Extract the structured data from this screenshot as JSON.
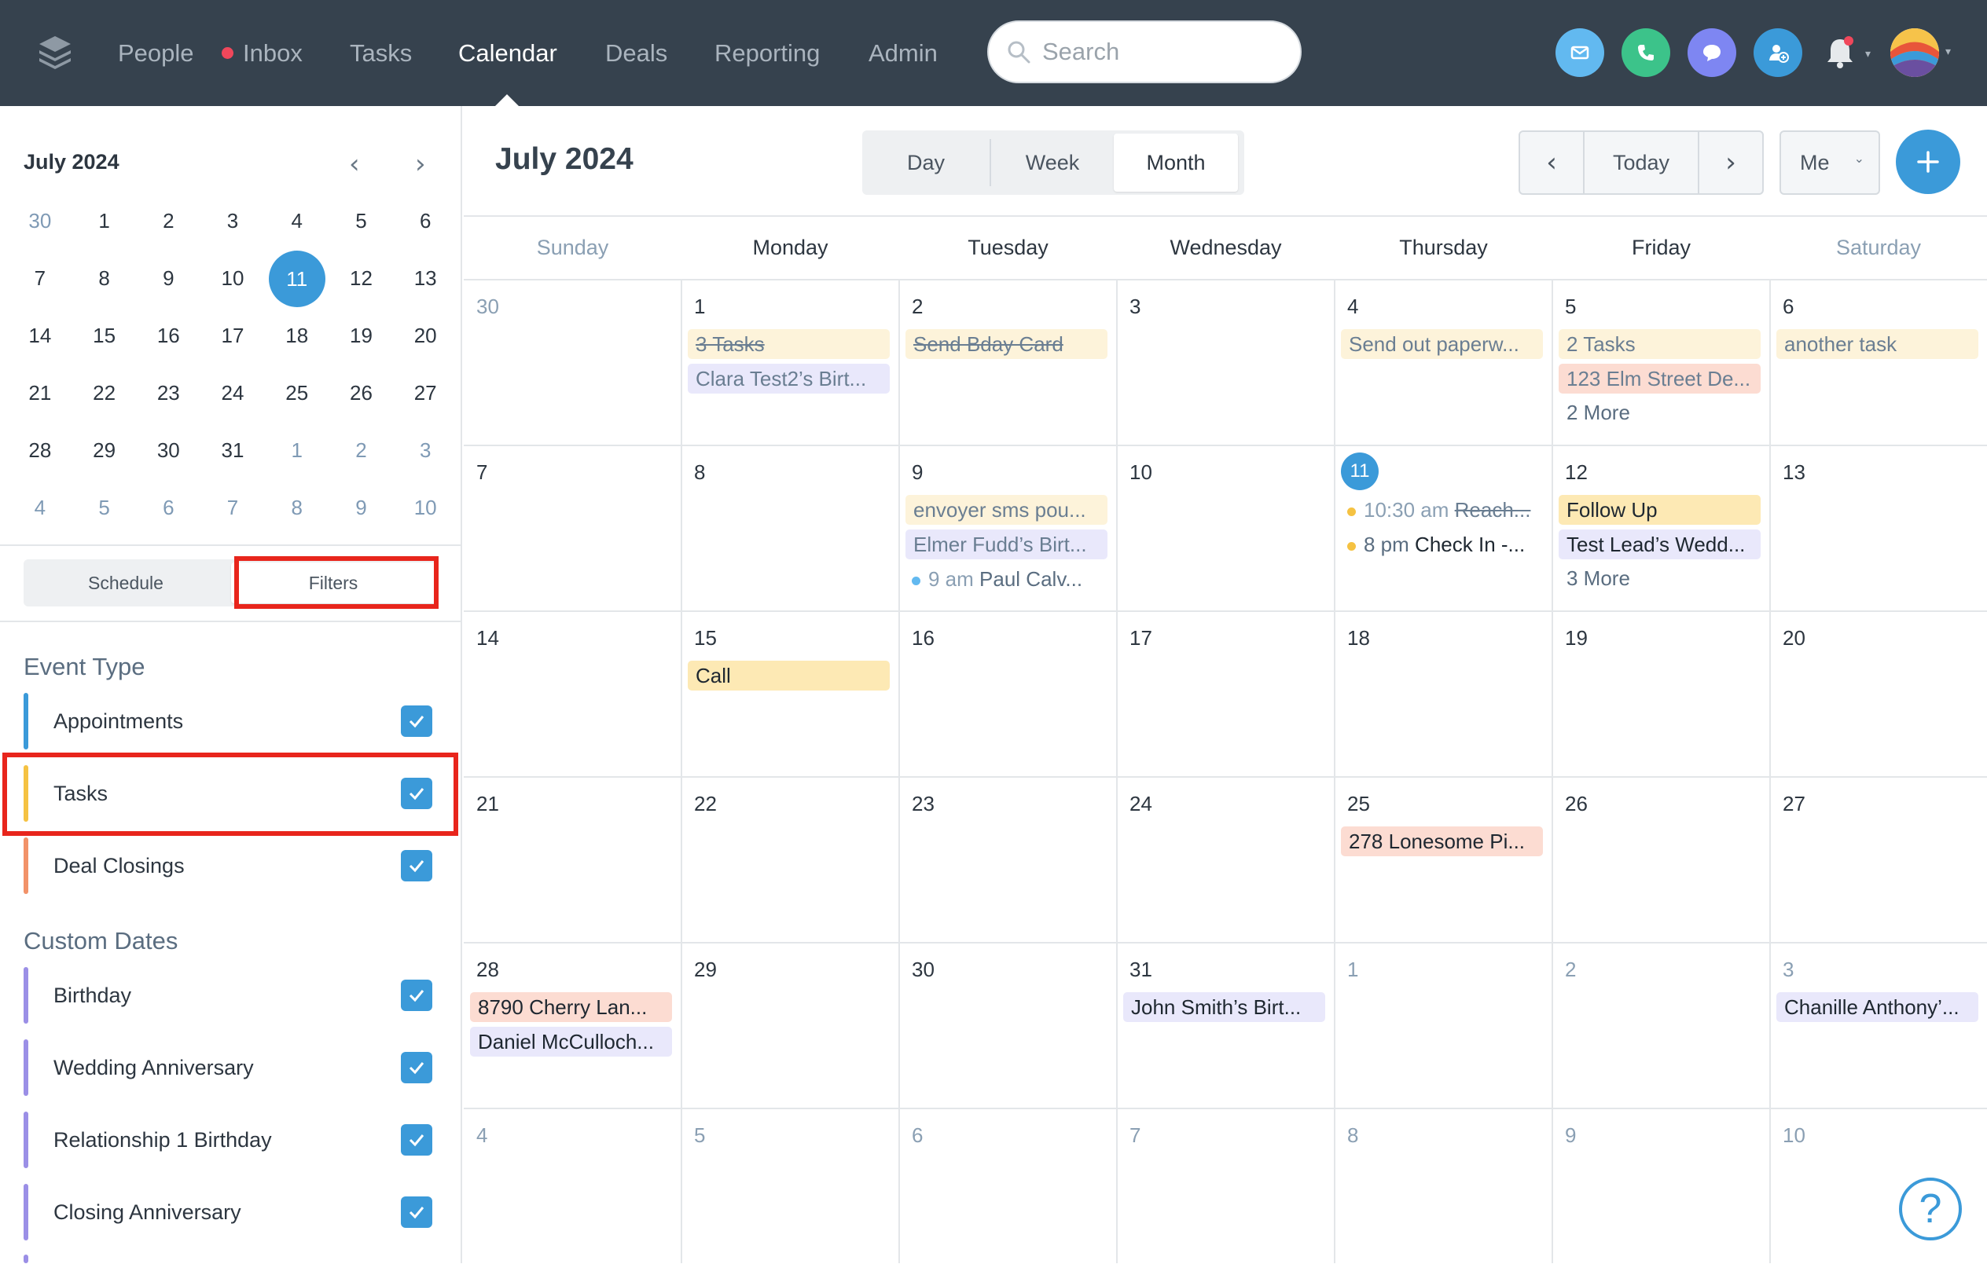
{
  "nav": {
    "people": "People",
    "inbox": "Inbox",
    "tasks": "Tasks",
    "calendar": "Calendar",
    "deals": "Deals",
    "reporting": "Reporting",
    "admin": "Admin"
  },
  "search": {
    "placeholder": "Search"
  },
  "colors": {
    "topbar": "#36424e",
    "accent": "#3b9ad9",
    "appointments": "#3b9ad9",
    "tasks": "#f5c242",
    "deal_closings": "#f29269",
    "custom_dates": "#9b8fe6"
  },
  "mini": {
    "title": "July 2024",
    "weeks": [
      [
        {
          "d": "30",
          "o": true
        },
        {
          "d": "1"
        },
        {
          "d": "2"
        },
        {
          "d": "3"
        },
        {
          "d": "4"
        },
        {
          "d": "5"
        },
        {
          "d": "6"
        }
      ],
      [
        {
          "d": "7"
        },
        {
          "d": "8"
        },
        {
          "d": "9"
        },
        {
          "d": "10"
        },
        {
          "d": "11",
          "t": true
        },
        {
          "d": "12"
        },
        {
          "d": "13"
        }
      ],
      [
        {
          "d": "14"
        },
        {
          "d": "15"
        },
        {
          "d": "16"
        },
        {
          "d": "17"
        },
        {
          "d": "18"
        },
        {
          "d": "19"
        },
        {
          "d": "20"
        }
      ],
      [
        {
          "d": "21"
        },
        {
          "d": "22"
        },
        {
          "d": "23"
        },
        {
          "d": "24"
        },
        {
          "d": "25"
        },
        {
          "d": "26"
        },
        {
          "d": "27"
        }
      ],
      [
        {
          "d": "28"
        },
        {
          "d": "29"
        },
        {
          "d": "30"
        },
        {
          "d": "31"
        },
        {
          "d": "1",
          "o": true
        },
        {
          "d": "2",
          "o": true
        },
        {
          "d": "3",
          "o": true
        }
      ],
      [
        {
          "d": "4",
          "o": true
        },
        {
          "d": "5",
          "o": true
        },
        {
          "d": "6",
          "o": true
        },
        {
          "d": "7",
          "o": true
        },
        {
          "d": "8",
          "o": true
        },
        {
          "d": "9",
          "o": true
        },
        {
          "d": "10",
          "o": true
        }
      ]
    ]
  },
  "sidebar_tabs": {
    "schedule": "Schedule",
    "filters": "Filters"
  },
  "event_type": {
    "title": "Event Type",
    "appointments": "Appointments",
    "tasks": "Tasks",
    "deal_closings": "Deal Closings"
  },
  "custom_dates": {
    "title": "Custom Dates",
    "birthday": "Birthday",
    "wedding": "Wedding Anniversary",
    "rel_birthday": "Relationship 1 Birthday",
    "closing": "Closing Anniversary"
  },
  "calendar": {
    "title": "July 2024",
    "view_day": "Day",
    "view_week": "Week",
    "view_month": "Month",
    "today": "Today",
    "me": "Me"
  },
  "days": [
    "Sunday",
    "Monday",
    "Tuesday",
    "Wednesday",
    "Thursday",
    "Friday",
    "Saturday"
  ],
  "cells": {
    "r0": [
      "30",
      "1",
      "2",
      "3",
      "4",
      "5",
      "6"
    ],
    "r1": [
      "7",
      "8",
      "9",
      "10",
      "11",
      "12",
      "13"
    ],
    "r2": [
      "14",
      "15",
      "16",
      "17",
      "18",
      "19",
      "20"
    ],
    "r3": [
      "21",
      "22",
      "23",
      "24",
      "25",
      "26",
      "27"
    ],
    "r4": [
      "28",
      "29",
      "30",
      "31",
      "1",
      "2",
      "3"
    ],
    "r5": [
      "4",
      "5",
      "6",
      "7",
      "8",
      "9",
      "10"
    ]
  },
  "events": {
    "mon1_a": "3 Tasks",
    "mon1_b": "Clara Test2’s Birt...",
    "tue2_a": "Send Bday Card",
    "thu4_a": "Send out paperw...",
    "fri5_a": "2 Tasks",
    "fri5_b": "123 Elm Street De...",
    "fri5_more": "2 More",
    "sat6_a": "another task",
    "tue9_a": "envoyer sms pou...",
    "tue9_b": "Elmer Fudd’s Birt...",
    "tue9_c_time": "9 am",
    "tue9_c_title": "Paul Calv...",
    "thu11_a_time": "10:30 am",
    "thu11_a_title": "Reach...",
    "thu11_b_time": "8 pm",
    "thu11_b_title": "Check In -...",
    "fri12_a": "Follow Up",
    "fri12_b": "Test Lead’s Wedd...",
    "fri12_more": "3 More",
    "mon15_a": "Call",
    "thu25_a": "278 Lonesome Pi...",
    "sun28_a": "8790 Cherry Lan...",
    "sun28_b": "Daniel McCulloch...",
    "wed31_a": "John Smith’s Birt...",
    "sat3_a": "Chanille Anthony’..."
  },
  "help": "?"
}
